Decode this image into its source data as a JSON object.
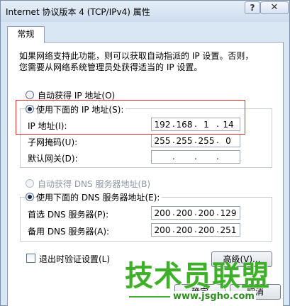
{
  "window": {
    "title": "Internet 协议版本 4 (TCP/IPv4) 属性",
    "help": "?",
    "close": "✕"
  },
  "tabs": [
    {
      "label": "常规"
    }
  ],
  "description": {
    "line1": "如果网络支持此功能，则可以获取自动指派的 IP 设置。否则，",
    "line2": "您需要从网络系统管理员处获得适当的 IP 设置。"
  },
  "ip": {
    "auto_label": "自动获得 IP 地址(O)",
    "manual_label": "使用下面的 IP 地址(S):",
    "ip_label": "IP 地址(I):",
    "ip_value": [
      "192",
      "168",
      "1",
      "14"
    ],
    "mask_label": "子网掩码(U):",
    "mask_value": [
      "255",
      "255",
      "255",
      "0"
    ],
    "gateway_label": "默认网关(D):",
    "gateway_value": [
      "",
      "",
      "",
      ""
    ]
  },
  "dns": {
    "auto_label": "自动获得 DNS 服务器地址(B)",
    "manual_label": "使用下面的 DNS 服务器地址(E):",
    "preferred_label": "首选 DNS 服务器(P):",
    "preferred_value": [
      "200",
      "200",
      "200",
      "129"
    ],
    "alternate_label": "备用 DNS 服务器(A):",
    "alternate_value": [
      "200",
      "200",
      "200",
      "251"
    ]
  },
  "validate_label": "退出时验证设置(L)",
  "advanced_button": "高级(V)...",
  "ok_button": "确定",
  "cancel_button": "取消",
  "watermark": {
    "main": "技术员联盟",
    "url": "www.jsgho.com"
  },
  "colors": {
    "highlight_border": "#e0302e",
    "watermark_green": "#3fae2a",
    "window_frame": "#d9e6f3"
  }
}
